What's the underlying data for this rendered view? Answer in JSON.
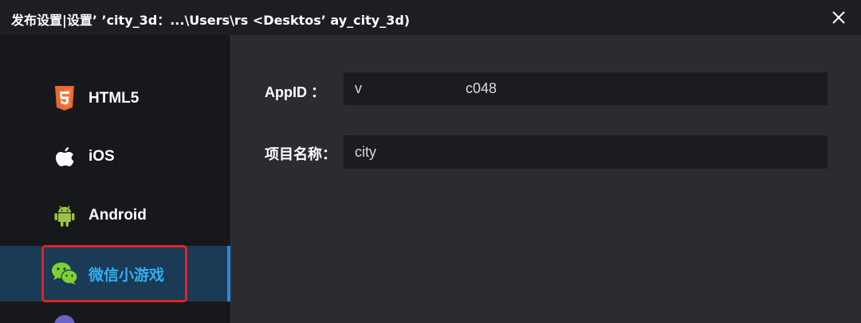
{
  "window": {
    "title": "发布设置|设置’ ʼcity_3d：...\\Users\\rs            <Desktosʼ          ay_city_3d)"
  },
  "sidebar": {
    "items": [
      {
        "label": "HTML5",
        "icon": "html5-icon",
        "color": "#e8692d"
      },
      {
        "label": "iOS",
        "icon": "apple-icon",
        "color": "#ffffff"
      },
      {
        "label": "Android",
        "icon": "android-icon",
        "color": "#9bc246"
      },
      {
        "label": "微信小游戏",
        "icon": "wechat-icon",
        "color": "#7fd12f",
        "active": true
      }
    ]
  },
  "form": {
    "appid_label": "AppID   ：",
    "appid_value": "v                          c048",
    "project_label": "项目名称：",
    "project_value": "city"
  },
  "colors": {
    "accent": "#2fb0f0",
    "highlight_border": "#e02323",
    "active_bg": "#1a3a56"
  }
}
